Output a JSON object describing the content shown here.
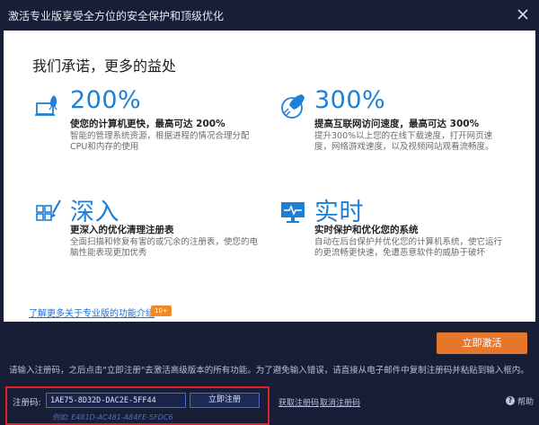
{
  "window": {
    "title": "激活专业版享受全方位的安全保护和顶级优化"
  },
  "panel": {
    "headline": "我们承诺，更多的益处",
    "features": [
      {
        "icon": "computer-rocket-icon",
        "big": "200%",
        "subtitle": "使您的计算机更快，最高可达 200%",
        "description": "智能的管理系统资源，根据进程的情况合理分配 CPU和内存的使用"
      },
      {
        "icon": "rocket-globe-icon",
        "big": "300%",
        "subtitle": "提高互联网访问速度，最高可达 300%",
        "description": "提升300%以上您的在线下载速度，打开网页速度，网络游戏速度，以及视频网站观看流畅度。"
      },
      {
        "icon": "grid-brush-icon",
        "big": "深入",
        "subtitle": "更深入的优化清理注册表",
        "description": "全面扫描和修复有害的或冗余的注册表，使您的电脑性能表现更加优秀"
      },
      {
        "icon": "monitor-pulse-icon",
        "big": "实时",
        "subtitle": "实时保护和优化您的系统",
        "description": "自动在后台保护并优化您的计算机系统，使它运行的更流畅更快速，免遭恶意软件的威胁于破坏"
      }
    ],
    "learn_more": "了解更多关于专业版的功能介绍",
    "badge": "10+"
  },
  "activate_label": "立即激活",
  "instructions": "请输入注册码，之后点击\"立即注册\"去激活高级版本的所有功能。为了避免输入错误，请直接从电子邮件中复制注册码并粘贴到输入框内。",
  "registration": {
    "label": "注册码:",
    "value": "1AE75-8D32D-DAC2E-5FF44",
    "button": "立即注册",
    "example": "例如: E481D-AC481-A84FE-5FDC6"
  },
  "links": {
    "get_code": "获取注册码",
    "remove_code": "取消注册码",
    "help": "帮助"
  },
  "colors": {
    "accent_blue": "#1d7fd6",
    "activate_orange": "#e6762c",
    "highlight_red": "#e0202a",
    "background": "#171e35"
  }
}
